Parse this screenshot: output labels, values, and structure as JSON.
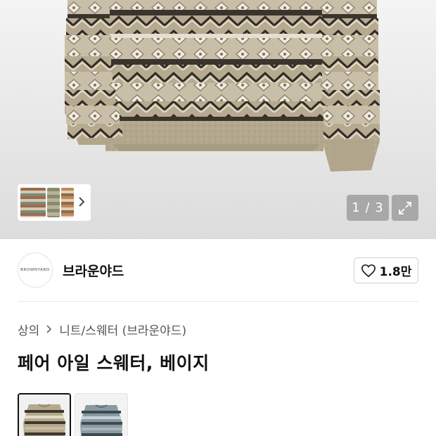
{
  "gallery": {
    "counter_text": "1 / 3",
    "thumbnails": [
      "sweater-front",
      "sweater-side",
      "sweater-detail"
    ],
    "colors": {
      "knit_base": "#b4a88e",
      "knit_dark": "#3a342c",
      "knit_light": "#e6dfcf"
    }
  },
  "brand": {
    "logo_text": "BROWNYARD",
    "name": "브라운야드",
    "like_count": "1.8만",
    "like_icon": "heart-outline-icon"
  },
  "breadcrumb": {
    "category": "상의",
    "subcategory": "니트/스웨터 (브라운야드)",
    "separator_icon": "chevron-right-icon"
  },
  "product": {
    "title": "페어 아일 스웨터, 베이지"
  },
  "color_options": [
    {
      "name": "beige",
      "selected": true,
      "swatch": "#b5a98d"
    },
    {
      "name": "blue",
      "selected": false,
      "swatch": "#8a9aa2"
    }
  ]
}
